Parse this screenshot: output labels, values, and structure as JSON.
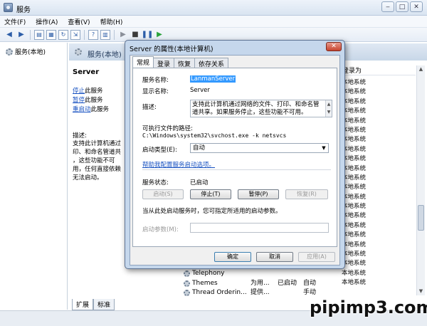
{
  "window": {
    "title": "服务"
  },
  "menu": [
    "文件(F)",
    "操作(A)",
    "查看(V)",
    "帮助(H)"
  ],
  "tree": {
    "item": "服务(本地)"
  },
  "right_header": {
    "title": "服务(本地)"
  },
  "detail": {
    "name": "Server",
    "actions": {
      "stop_link": "停止",
      "stop_suffix": "此服务",
      "pause_link": "暂停",
      "pause_suffix": "此服务",
      "restart_link": "重启动",
      "restart_suffix": "此服务"
    },
    "desc_label": "描述:",
    "desc_text": "支持此计算机通过\n印、和命名管道共\n，这些功能不可\n用，任何直接依赖\n无法启动。"
  },
  "list": {
    "logon_header": "登录为",
    "logon_values": [
      "本地系统",
      "本地系统",
      "本地系统",
      "本地系统",
      "本地系统",
      "本地系统",
      "本地系统",
      "本地系统",
      "本地系统",
      "本地系统",
      "本地系统",
      "本地系统",
      "本地系统",
      "本地系统",
      "本地系统",
      "本地系统",
      "本地系统",
      "本地系统",
      "本地系统",
      "本地系统",
      "本地系统",
      "本地系统"
    ],
    "rows": [
      {
        "name": "Telephony",
        "desc": "",
        "status": "",
        "startup": "",
        "logon": ""
      },
      {
        "name": "Themes",
        "desc": "为用...",
        "status": "已启动",
        "startup": "自动",
        "logon": "本地系统"
      },
      {
        "name": "Thread Orderin...",
        "desc": "提供...",
        "status": "",
        "startup": "手动",
        "logon": "本地服务"
      }
    ]
  },
  "bottom_tabs": [
    "扩展",
    "标准"
  ],
  "watermark": "pipimp3.com",
  "dialog": {
    "title": "Server 的属性(本地计算机)",
    "close": "✕",
    "tabs": [
      "常规",
      "登录",
      "恢复",
      "依存关系"
    ],
    "service_name_label": "服务名称:",
    "service_name": "LanmanServer",
    "display_name_label": "显示名称:",
    "display_name": "Server",
    "desc_label": "描述:",
    "desc_value": "支持此计算机通过网络的文件、打印、和命名管道共享。如果服务停止，这些功能不可用。",
    "exe_path_label": "可执行文件的路径:",
    "exe_path": "C:\\Windows\\system32\\svchost.exe -k netsvcs",
    "startup_type_label": "启动类型(E):",
    "startup_type": "自动",
    "help_link": "帮助我配置服务启动选项。",
    "status_label": "服务状态:",
    "status_value": "已启动",
    "btn_start": "启动(S)",
    "btn_stop": "停止(T)",
    "btn_pause": "暂停(P)",
    "btn_resume": "恢复(R)",
    "params_note": "当从此处启动服务时，您可指定所适用的启动参数。",
    "params_label": "启动参数(M):",
    "btn_ok": "确定",
    "btn_cancel": "取消",
    "btn_apply": "应用(A)"
  }
}
